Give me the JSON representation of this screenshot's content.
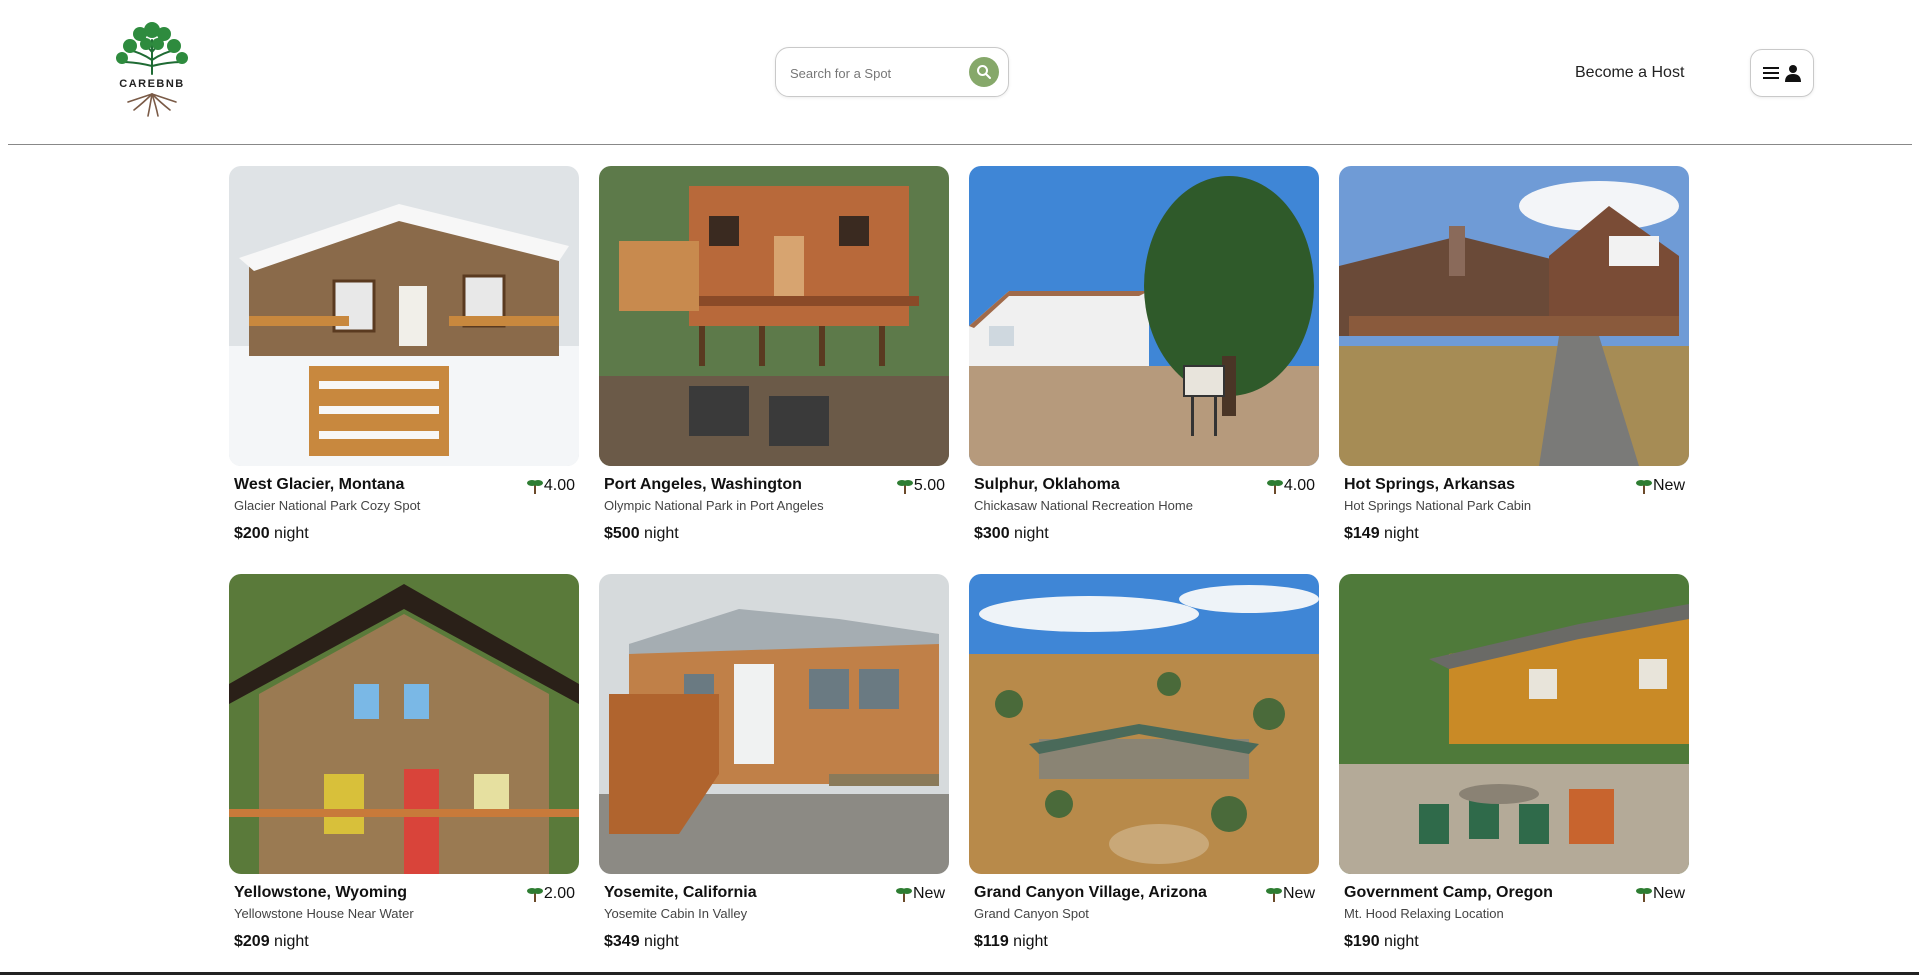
{
  "header": {
    "logo_text": "CAREBNB",
    "search": {
      "placeholder": "Search for a Spot",
      "icon": "search-icon"
    },
    "become_host_label": "Become a Host",
    "menu": {
      "icons": [
        "menu-icon",
        "user-icon"
      ]
    }
  },
  "listings": [
    {
      "location": "West Glacier, Montana",
      "rating": "4.00",
      "description": "Glacier National Park Cozy Spot",
      "price": "$200",
      "price_unit": "night"
    },
    {
      "location": "Port Angeles, Washington",
      "rating": "5.00",
      "description": "Olympic National Park in Port Angeles",
      "price": "$500",
      "price_unit": "night"
    },
    {
      "location": "Sulphur, Oklahoma",
      "rating": "4.00",
      "description": "Chickasaw National Recreation Home",
      "price": "$300",
      "price_unit": "night"
    },
    {
      "location": "Hot Springs, Arkansas",
      "rating": "New",
      "description": "Hot Springs National Park Cabin",
      "price": "$149",
      "price_unit": "night"
    },
    {
      "location": "Yellowstone, Wyoming",
      "rating": "2.00",
      "description": "Yellowstone House Near Water",
      "price": "$209",
      "price_unit": "night"
    },
    {
      "location": "Yosemite, California",
      "rating": "New",
      "description": "Yosemite Cabin In Valley",
      "price": "$349",
      "price_unit": "night"
    },
    {
      "location": "Grand Canyon Village, Arizona",
      "rating": "New",
      "description": "Grand Canyon Spot",
      "price": "$119",
      "price_unit": "night"
    },
    {
      "location": "Government Camp, Oregon",
      "rating": "New",
      "description": "Mt. Hood Relaxing Location",
      "price": "$190",
      "price_unit": "night"
    }
  ],
  "colors": {
    "accent": "#86a86a",
    "rating_icon": "#2e7d32"
  }
}
